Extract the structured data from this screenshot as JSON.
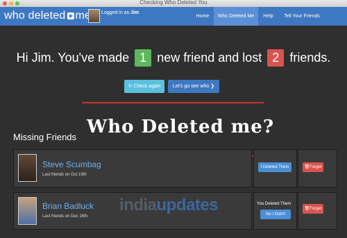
{
  "window": {
    "title": "Checking Who Deleted You"
  },
  "navbar": {
    "brand_prefix": "who deleted",
    "brand_suffix": "me",
    "logged_in_prefix": "Logged in as ",
    "username": "Jim",
    "links": [
      {
        "label": "Home",
        "active": false
      },
      {
        "label": "Who Deleted Me",
        "active": true
      },
      {
        "label": "Help",
        "active": false
      },
      {
        "label": "Tell Your Friends",
        "active": false
      }
    ]
  },
  "summary": {
    "part1": "Hi Jim. You've made",
    "new_count": "1",
    "part2": "new friend and lost",
    "lost_count": "2",
    "part3": "friends.",
    "check_again": "Check again",
    "lets_go": "Let's go see who"
  },
  "missing": {
    "heading": "Missing Friends",
    "friends": [
      {
        "name": "Steve Scumbag",
        "last": "Last friends on Oct 19th",
        "status_label": "",
        "action": "I Deleted Them",
        "forget": "Forget"
      },
      {
        "name": "Brian Badluck",
        "last": "Last friends on Dec 16th",
        "status_label": "You Deleted Them",
        "action": "No I Didn't",
        "forget": "Forget"
      }
    ]
  },
  "overlay": {
    "title": "Who Deleted me?"
  },
  "watermark": {
    "text_a": "india",
    "text_b": "updates"
  },
  "colors": {
    "navbar": "#3f78c2",
    "accent_blue": "#4b8fd6",
    "success": "#5cb85c",
    "danger": "#d9534f",
    "check_again": "#5bc0de",
    "link_name": "#6fb0f0"
  },
  "icons": [
    "refresh-icon",
    "chevron-right-icon",
    "trash-icon",
    "play-icon"
  ]
}
